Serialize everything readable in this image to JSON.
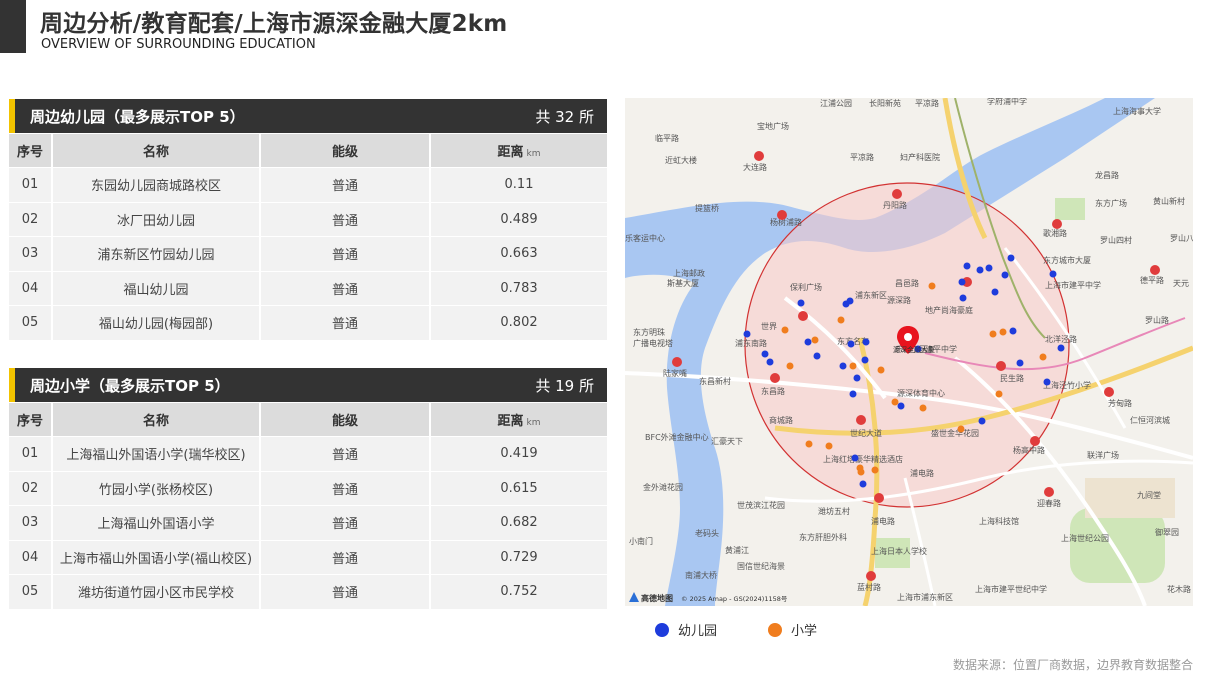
{
  "header": {
    "title": "周边分析/教育配套/上海市源深金融大厦2km",
    "subtitle": "OVERVIEW OF SURROUNDING EDUCATION"
  },
  "kindergarten": {
    "title": "周边幼儿园（最多展示TOP 5）",
    "count": "共 32 所",
    "columns": [
      "序号",
      "名称",
      "能级",
      "距离"
    ],
    "distance_unit": "km",
    "rows": [
      {
        "no": "01",
        "name": "东园幼儿园商城路校区",
        "level": "普通",
        "distance": "0.11"
      },
      {
        "no": "02",
        "name": "冰厂田幼儿园",
        "level": "普通",
        "distance": "0.489"
      },
      {
        "no": "03",
        "name": "浦东新区竹园幼儿园",
        "level": "普通",
        "distance": "0.663"
      },
      {
        "no": "04",
        "name": "福山幼儿园",
        "level": "普通",
        "distance": "0.783"
      },
      {
        "no": "05",
        "name": "福山幼儿园(梅园部)",
        "level": "普通",
        "distance": "0.802"
      }
    ]
  },
  "primary": {
    "title": "周边小学（最多展示TOP 5）",
    "count": "共 19 所",
    "columns": [
      "序号",
      "名称",
      "能级",
      "距离"
    ],
    "distance_unit": "km",
    "rows": [
      {
        "no": "01",
        "name": "上海福山外国语小学(瑞华校区)",
        "level": "普通",
        "distance": "0.419"
      },
      {
        "no": "02",
        "name": "竹园小学(张杨校区)",
        "level": "普通",
        "distance": "0.615"
      },
      {
        "no": "03",
        "name": "上海福山外国语小学",
        "level": "普通",
        "distance": "0.682"
      },
      {
        "no": "04",
        "name": "上海市福山外国语小学(福山校区)",
        "level": "普通",
        "distance": "0.729"
      },
      {
        "no": "05",
        "name": "潍坊街道竹园小区市民学校",
        "level": "普通",
        "distance": "0.752"
      }
    ]
  },
  "map": {
    "labels": [
      "江浦公园",
      "长阳新苑",
      "平凉路",
      "学府浦中学",
      "上海海事大学",
      "宝地广场",
      "临平路",
      "近虹大楼",
      "大连路",
      "平凉路",
      "妇产科医院",
      "提篮桥",
      "杨树浦路",
      "丹阳路",
      "龙昌路",
      "东方广场",
      "黄山新村",
      "乐客运中心",
      "歌湘路",
      "罗山四村",
      "罗山八村",
      "上海邮政",
      "斯基大厦",
      "东方城市大厦",
      "上海市建平中学",
      "德平路",
      "天元",
      "保利广场",
      "昌邑路",
      "浦东新区",
      "源深路",
      "地产尚海豪庭",
      "东方明珠",
      "广播电视塔",
      "浦东南路",
      "世界",
      "东方名车",
      "乐坊小区",
      "建平中学",
      "北洋泾路",
      "罗山路",
      "陆家嘴",
      "东昌新村",
      "东昌路",
      "源深体育中心",
      "民生路",
      "上海泾竹小学",
      "芳甸路",
      "商城路",
      "世纪大道",
      "盛世金华花园",
      "杨高中路",
      "BFC外滩金融中心",
      "汇豪天下",
      "上海红塔豪华精选酒店",
      "浦电路",
      "联洋广场",
      "仁恒河滨城",
      "金外滩花园",
      "世茂滨江花园",
      "潍坊五村",
      "上海科技馆",
      "迎春路",
      "九间堂",
      "小南门",
      "老码头",
      "东方肝胆外科",
      "浦电路",
      "上海世纪公园",
      "御翠园",
      "上海日本人学校",
      "黄浦江",
      "国信世纪海景",
      "蓝村路",
      "上海市建平世纪中学",
      "花木路",
      "南浦大桥",
      "上海市浦东新区"
    ],
    "attribution": "© 2025 Amap - GS(2024)1158号",
    "logo_text": "高德地图",
    "center_label": "源深金融大厦"
  },
  "legend": {
    "kindergarten_label": "幼儿园",
    "kindergarten_color": "#1E3CDC",
    "primary_label": "小学",
    "primary_color": "#F07D1E"
  },
  "footer": {
    "source": "数据来源：位置厂商数据，边界教育数据整合"
  }
}
